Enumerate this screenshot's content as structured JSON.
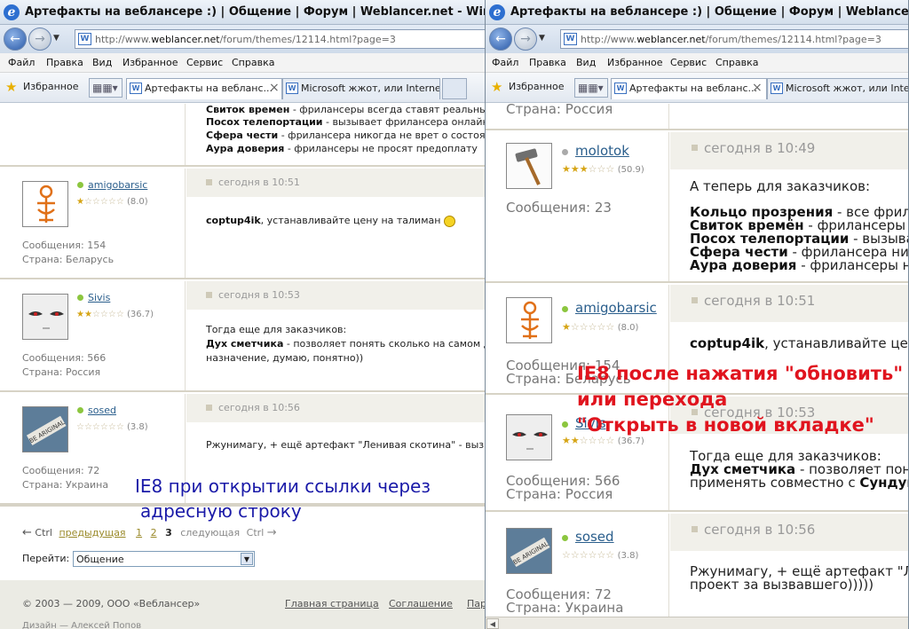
{
  "left": {
    "title": "Артефакты на вебланcере :) | Общение | Форум | Weblancer.net - Windows Internet Explorer",
    "url_prefix": "http://www.",
    "url_domain": "weblancer.net",
    "url_path": "/forum/themes/12114.html?page=3",
    "menu": [
      "Файл",
      "Правка",
      "Вид",
      "Избранное",
      "Сервис",
      "Справка"
    ],
    "favorites": "Избранное",
    "tab1": "Артефакты на вебланс...",
    "tab2": "Microsoft жжот, или Interne...",
    "tab_close": "×",
    "top_lines": [
      {
        "b": "Свиток времен",
        "t": " - фрилансеры всегда ставят реальные сроки"
      },
      {
        "b": "Посох телепортации",
        "t": " - вызывает фрилансера онлайн в любое"
      },
      {
        "b": "Сфера чести",
        "t": " - фрилансера никогда не врет о состоянии дел"
      },
      {
        "b": "Аура доверия",
        "t": " - фрилансеры не просят предоплату"
      }
    ],
    "posts": [
      {
        "user": "amigobarsic",
        "rating": "(8.0)",
        "messages": "Сообщения: 154",
        "country": "Страна: Беларусь",
        "time": "сегодня в 10:51",
        "text_b": "coptup4ik",
        "text": ", устанавливайте цену на талиман"
      },
      {
        "user": "Sivis",
        "rating": "(36.7)",
        "messages": "Сообщения: 566",
        "country": "Страна: Россия",
        "time": "сегодня в 10:53",
        "line1": "Тогда еще для заказчиков:",
        "line2_b": "Дух сметчика",
        "line2": " - позволяет понять сколько на самом деле ст",
        "line3": "назначение, думаю, понятно))"
      },
      {
        "user": "sosed",
        "rating": "(3.8)",
        "messages": "Сообщения: 72",
        "country": "Страна: Украина",
        "time": "сегодня в 10:56",
        "text": "Ржунимагу, + ещё артефакт \"Ленивая скотина\" - вызывает к"
      }
    ],
    "pager": {
      "arrow_left": "←",
      "ctrl1": "Ctrl",
      "prev": "предыдущая",
      "p1": "1",
      "p2": "2",
      "p3": "3",
      "next": "следующая",
      "ctrl2": "Ctrl",
      "arrow_right": "→"
    },
    "goto_label": "Перейти:",
    "goto_value": "Общение",
    "footer_copy": "© 2003 — 2009, ООО «Вебланcер»",
    "footer_links": [
      "Главная страница",
      "Соглашение",
      "Пар"
    ],
    "footer_line2": "Дизайн — Алексей Попов",
    "overlay1": "IE8 при открытии ссылки через",
    "overlay2": "адресную строку",
    "overlay_color": "#1a1aa8"
  },
  "right": {
    "title": "Артефакты на вебланcере :) | Общение | Форум | Weblancer.net - Windows Internet Explorer",
    "url_prefix": "http://www.",
    "url_domain": "weblancer.net",
    "url_path": "/forum/themes/12114.html?page=3",
    "menu": [
      "Файл",
      "Правка",
      "Вид",
      "Избранное",
      "Сервис",
      "Справка"
    ],
    "favorites": "Избранное",
    "tab1": "Артефакты на вебланс...",
    "tab2": "Microsoft жжот, или Interne...",
    "tab_close": "×",
    "top_country": "Страна: Россия",
    "posts": [
      {
        "user": "molotok",
        "rating": "(50.9)",
        "messages": "Сообщения: 23",
        "time": "сегодня в 10:49",
        "intro": "А теперь для заказчиков:",
        "lines": [
          {
            "b": "Кольцо прозрения",
            "t": " - все фрила"
          },
          {
            "b": "Свиток времён",
            "t": " - фрилансеры в"
          },
          {
            "b": "Посох телепортации",
            "t": " - вызыва"
          },
          {
            "b": "Сфера чести",
            "t": " - фрилансера нико"
          },
          {
            "b": "Аура доверия",
            "t": " - фрилансеры не"
          }
        ]
      },
      {
        "user": "amigobarsic",
        "rating": "(8.0)",
        "messages": "Сообщения: 154",
        "country": "Страна: Беларусь",
        "time": "сегодня в 10:51",
        "text_b": "coptup4ik",
        "text": ", устанавливайте цену"
      },
      {
        "user": "Sivis",
        "rating": "(36.7)",
        "messages": "Сообщения: 566",
        "country": "Страна: Россия",
        "time": "сегодня в 10:53",
        "line1": "Тогда еще для заказчиков:",
        "line2_b": "Дух сметчика",
        "line2": " - позволяет поня",
        "line3": "применять совместно с ",
        "line3_b": "Сундуко"
      },
      {
        "user": "sosed",
        "rating": "(3.8)",
        "messages": "Сообщения: 72",
        "country": "Страна: Украина",
        "time": "сегодня в 10:56",
        "line1": "Ржунимагу, + ещё артефакт \"Лен",
        "line2": "проект за вызвавшего)))))"
      }
    ],
    "overlay1": "IE8 после нажатия \"обновить\"",
    "overlay2": "или перехода",
    "overlay3": "\"Открыть в новой вкладке\"",
    "overlay_color": "#e0141e"
  }
}
